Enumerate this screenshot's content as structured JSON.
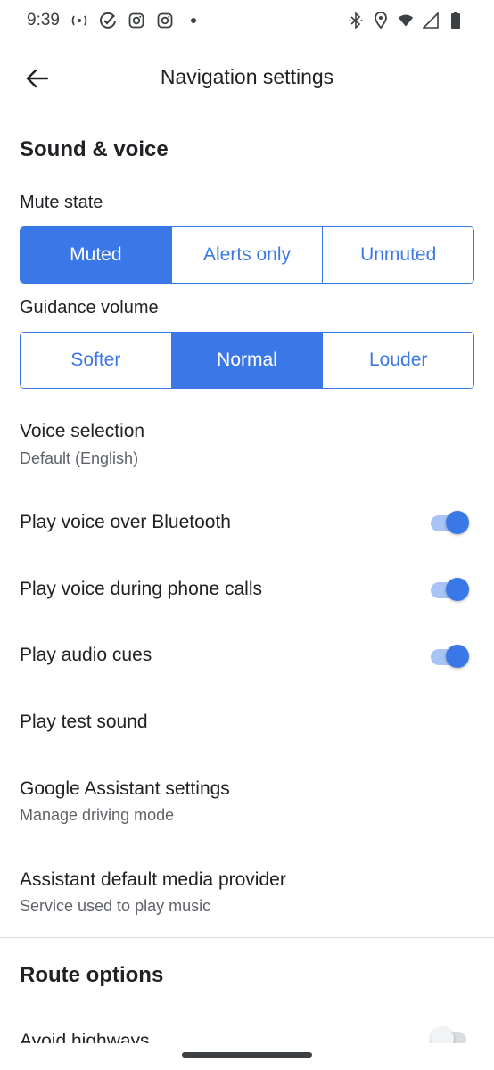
{
  "status_bar": {
    "time": "9:39",
    "left_icons": [
      "hotspot-icon",
      "check-circle-icon",
      "instagram-icon",
      "instagram-icon",
      "dot-icon"
    ],
    "right_icons": [
      "bluetooth-icon",
      "location-icon",
      "wifi-icon",
      "signal-icon",
      "battery-icon"
    ]
  },
  "app_bar": {
    "title": "Navigation settings"
  },
  "sound_voice": {
    "section_title": "Sound & voice",
    "mute_state": {
      "label": "Mute state",
      "options": [
        "Muted",
        "Alerts only",
        "Unmuted"
      ],
      "selected": "Muted"
    },
    "guidance_volume": {
      "label": "Guidance volume",
      "options": [
        "Softer",
        "Normal",
        "Louder"
      ],
      "selected": "Normal"
    },
    "voice_selection": {
      "title": "Voice selection",
      "subtitle": "Default (English)"
    },
    "bluetooth": {
      "title": "Play voice over Bluetooth",
      "enabled": true
    },
    "phone_calls": {
      "title": "Play voice during phone calls",
      "enabled": true
    },
    "audio_cues": {
      "title": "Play audio cues",
      "enabled": true
    },
    "test_sound": {
      "title": "Play test sound"
    },
    "assistant_settings": {
      "title": "Google Assistant settings",
      "subtitle": "Manage driving mode"
    },
    "media_provider": {
      "title": "Assistant default media provider",
      "subtitle": "Service used to play music"
    }
  },
  "route_options": {
    "section_title": "Route options",
    "partial_row": {
      "title": "Avoid highways",
      "enabled": false
    }
  },
  "colors": {
    "accent": "#3b78e7",
    "toggle_track_on": "#a8c4f4",
    "text_primary": "#202124",
    "text_secondary": "#5f6368"
  }
}
